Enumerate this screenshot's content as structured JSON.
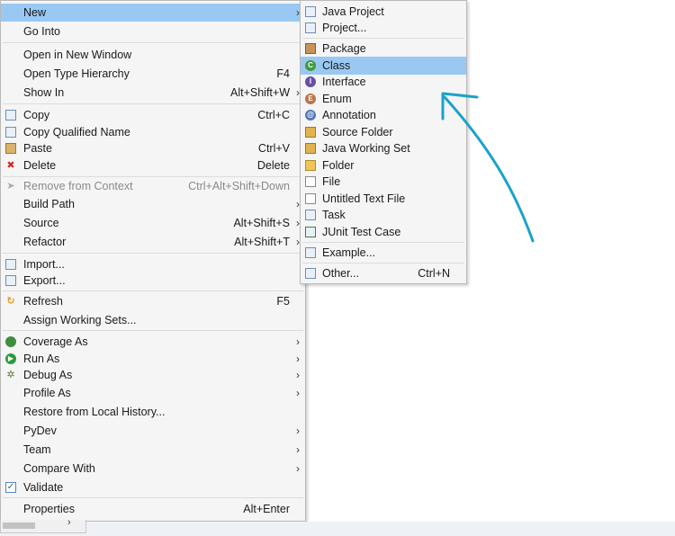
{
  "main_menu": {
    "items": [
      {
        "label": "New",
        "shortcut": "",
        "arrow": true
      },
      {
        "label": "Go Into",
        "shortcut": ""
      },
      {
        "label": "Open in New Window",
        "shortcut": ""
      },
      {
        "label": "Open Type Hierarchy",
        "shortcut": "F4"
      },
      {
        "label": "Show In",
        "shortcut": "Alt+Shift+W",
        "arrow": true
      },
      {
        "label": "Copy",
        "shortcut": "Ctrl+C",
        "icon": "copy-icon"
      },
      {
        "label": "Copy Qualified Name",
        "shortcut": "",
        "icon": "copy-qualified-icon"
      },
      {
        "label": "Paste",
        "shortcut": "Ctrl+V",
        "icon": "paste-icon"
      },
      {
        "label": "Delete",
        "shortcut": "Delete",
        "icon": "delete-icon"
      },
      {
        "label": "Remove from Context",
        "shortcut": "Ctrl+Alt+Shift+Down",
        "icon": "remove-context-icon",
        "disabled": true
      },
      {
        "label": "Build Path",
        "shortcut": "",
        "arrow": true
      },
      {
        "label": "Source",
        "shortcut": "Alt+Shift+S",
        "arrow": true
      },
      {
        "label": "Refactor",
        "shortcut": "Alt+Shift+T",
        "arrow": true
      },
      {
        "label": "Import...",
        "shortcut": "",
        "icon": "import-icon"
      },
      {
        "label": "Export...",
        "shortcut": "",
        "icon": "export-icon"
      },
      {
        "label": "Refresh",
        "shortcut": "F5",
        "icon": "refresh-icon"
      },
      {
        "label": "Assign Working Sets...",
        "shortcut": ""
      },
      {
        "label": "Coverage As",
        "shortcut": "",
        "icon": "coverage-icon",
        "arrow": true
      },
      {
        "label": "Run As",
        "shortcut": "",
        "icon": "run-icon",
        "arrow": true
      },
      {
        "label": "Debug As",
        "shortcut": "",
        "icon": "debug-icon",
        "arrow": true
      },
      {
        "label": "Profile As",
        "shortcut": "",
        "arrow": true
      },
      {
        "label": "Restore from Local History...",
        "shortcut": ""
      },
      {
        "label": "PyDev",
        "shortcut": "",
        "arrow": true
      },
      {
        "label": "Team",
        "shortcut": "",
        "arrow": true
      },
      {
        "label": "Compare With",
        "shortcut": "",
        "arrow": true
      },
      {
        "label": "Validate",
        "shortcut": "",
        "icon": "checkbox-checked-icon"
      },
      {
        "label": "Properties",
        "shortcut": "Alt+Enter"
      }
    ]
  },
  "sub_menu": {
    "items": [
      {
        "label": "Java Project",
        "shortcut": "",
        "icon": "java-project-icon"
      },
      {
        "label": "Project...",
        "shortcut": "",
        "icon": "project-icon"
      },
      {
        "label": "Package",
        "shortcut": "",
        "icon": "package-icon"
      },
      {
        "label": "Class",
        "shortcut": "",
        "icon": "class-icon",
        "highlighted": true
      },
      {
        "label": "Interface",
        "shortcut": "",
        "icon": "interface-icon"
      },
      {
        "label": "Enum",
        "shortcut": "",
        "icon": "enum-icon"
      },
      {
        "label": "Annotation",
        "shortcut": "",
        "icon": "annotation-icon"
      },
      {
        "label": "Source Folder",
        "shortcut": "",
        "icon": "source-folder-icon"
      },
      {
        "label": "Java Working Set",
        "shortcut": "",
        "icon": "java-working-set-icon"
      },
      {
        "label": "Folder",
        "shortcut": "",
        "icon": "folder-icon"
      },
      {
        "label": "File",
        "shortcut": "",
        "icon": "file-icon"
      },
      {
        "label": "Untitled Text File",
        "shortcut": "",
        "icon": "untitled-text-file-icon"
      },
      {
        "label": "Task",
        "shortcut": "",
        "icon": "task-icon"
      },
      {
        "label": "JUnit Test Case",
        "shortcut": "",
        "icon": "junit-icon"
      },
      {
        "label": "Example...",
        "shortcut": "",
        "icon": "example-icon"
      },
      {
        "label": "Other...",
        "shortcut": "Ctrl+N",
        "icon": "other-icon"
      }
    ]
  },
  "arrow_glyph": "›",
  "colors": {
    "highlight": "#99c9f3",
    "annotation_arrow": "#1aa3c8"
  }
}
